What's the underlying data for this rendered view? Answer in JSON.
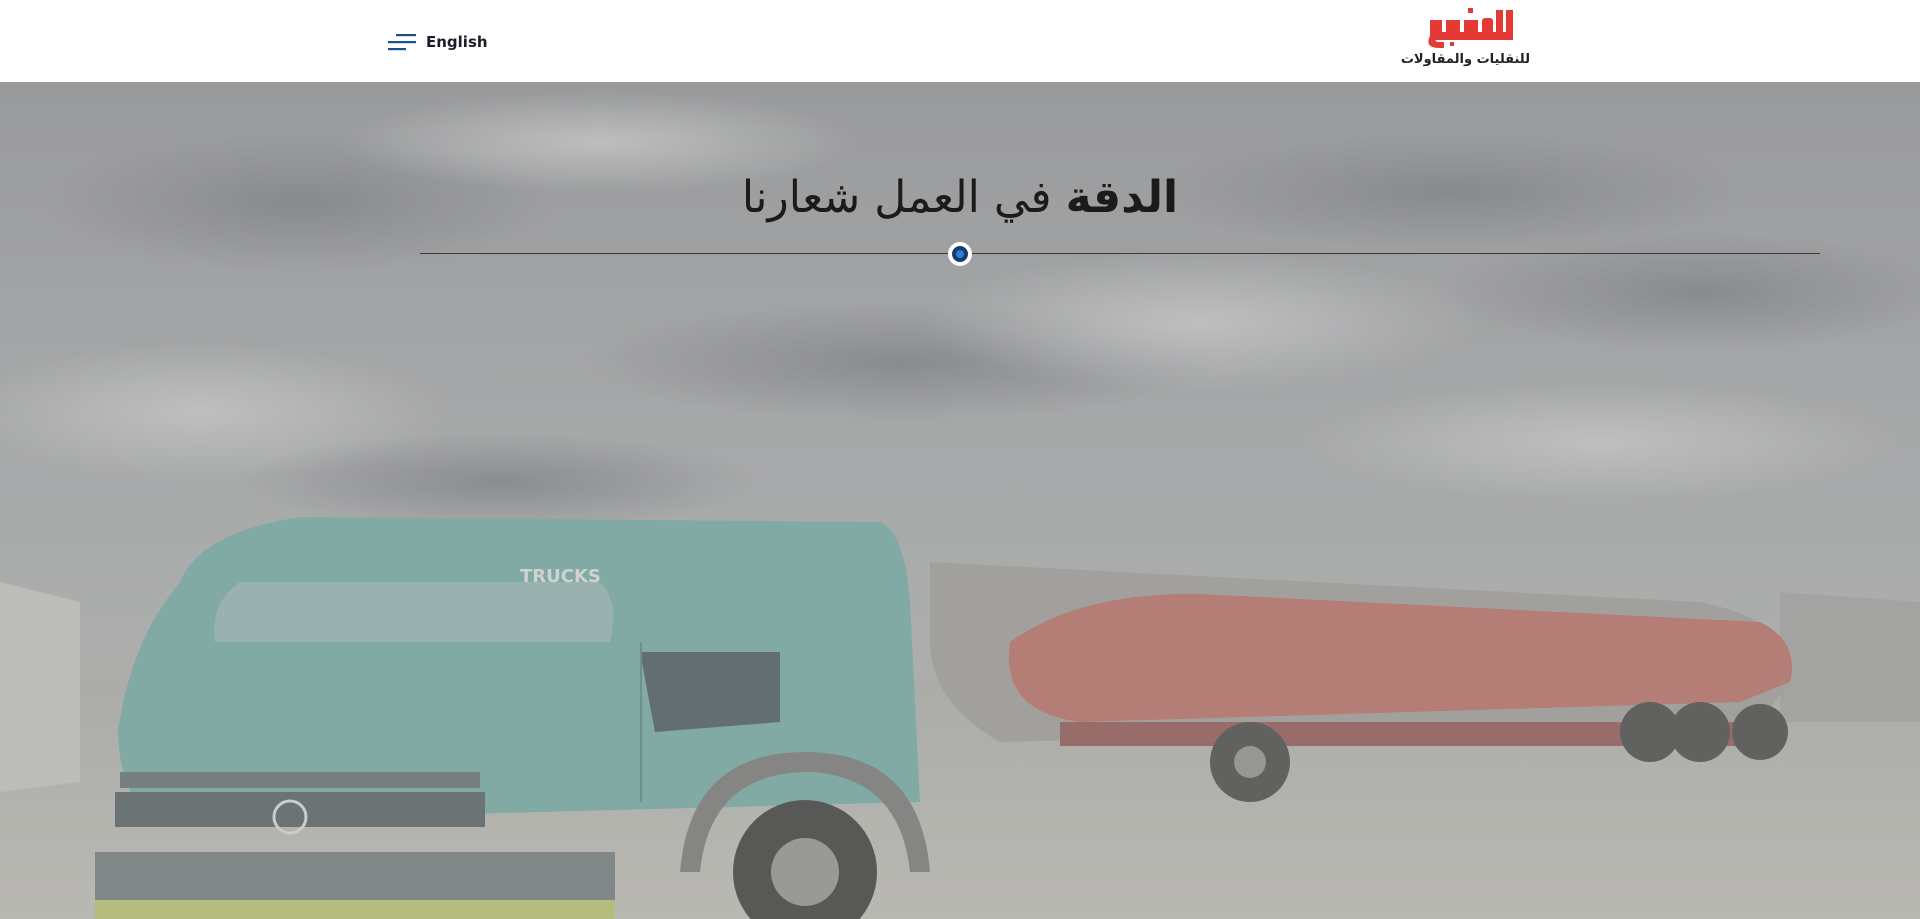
{
  "header": {
    "language_toggle": "English",
    "logo": {
      "brand_name": "الدخيل",
      "tagline": "للنقليات والمقاولات"
    }
  },
  "hero": {
    "title_strong": "الدقة",
    "title_rest": "في العمل شعارنا",
    "background_description_icon": "truck-photo"
  },
  "colors": {
    "brand_red": "#e53935",
    "menu_icon_blue": "#1f4e8c",
    "divider_dot": "#123d6e"
  }
}
